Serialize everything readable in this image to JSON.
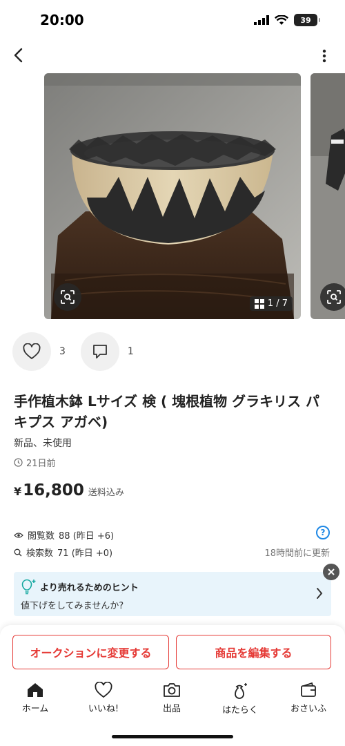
{
  "status_bar": {
    "time": "20:00",
    "battery": "39"
  },
  "product": {
    "photo_counter": "1 / 7",
    "likes_count": "3",
    "comments_count": "1",
    "title": "手作植木鉢 Lサイズ 検 ( 塊根植物 グラキリス パキプス アガベ)",
    "condition": "新品、未使用",
    "posted": "21日前",
    "price_currency": "¥",
    "price_amount": "16,800",
    "price_note": "送料込み"
  },
  "stats": {
    "views_label": "閲覧数",
    "views_value": "88 (昨日 +6)",
    "searches_label": "検索数",
    "searches_value": "71 (昨日 +0)",
    "updated": "18時間前に更新"
  },
  "hint": {
    "title": "より売れるためのヒント",
    "subtitle": "値下げをしてみませんか?"
  },
  "buttons": {
    "auction": "オークションに変更する",
    "edit": "商品を編集する"
  },
  "tabs": [
    {
      "label": "ホーム",
      "icon": "home-icon"
    },
    {
      "label": "いいね!",
      "icon": "heart-icon"
    },
    {
      "label": "出品",
      "icon": "camera-icon"
    },
    {
      "label": "はたらく",
      "icon": "bag-icon"
    },
    {
      "label": "おさいふ",
      "icon": "wallet-icon"
    }
  ],
  "colors": {
    "accent": "#e53935",
    "hint_bg": "#e8f4fb",
    "help_blue": "#1e88e5"
  }
}
